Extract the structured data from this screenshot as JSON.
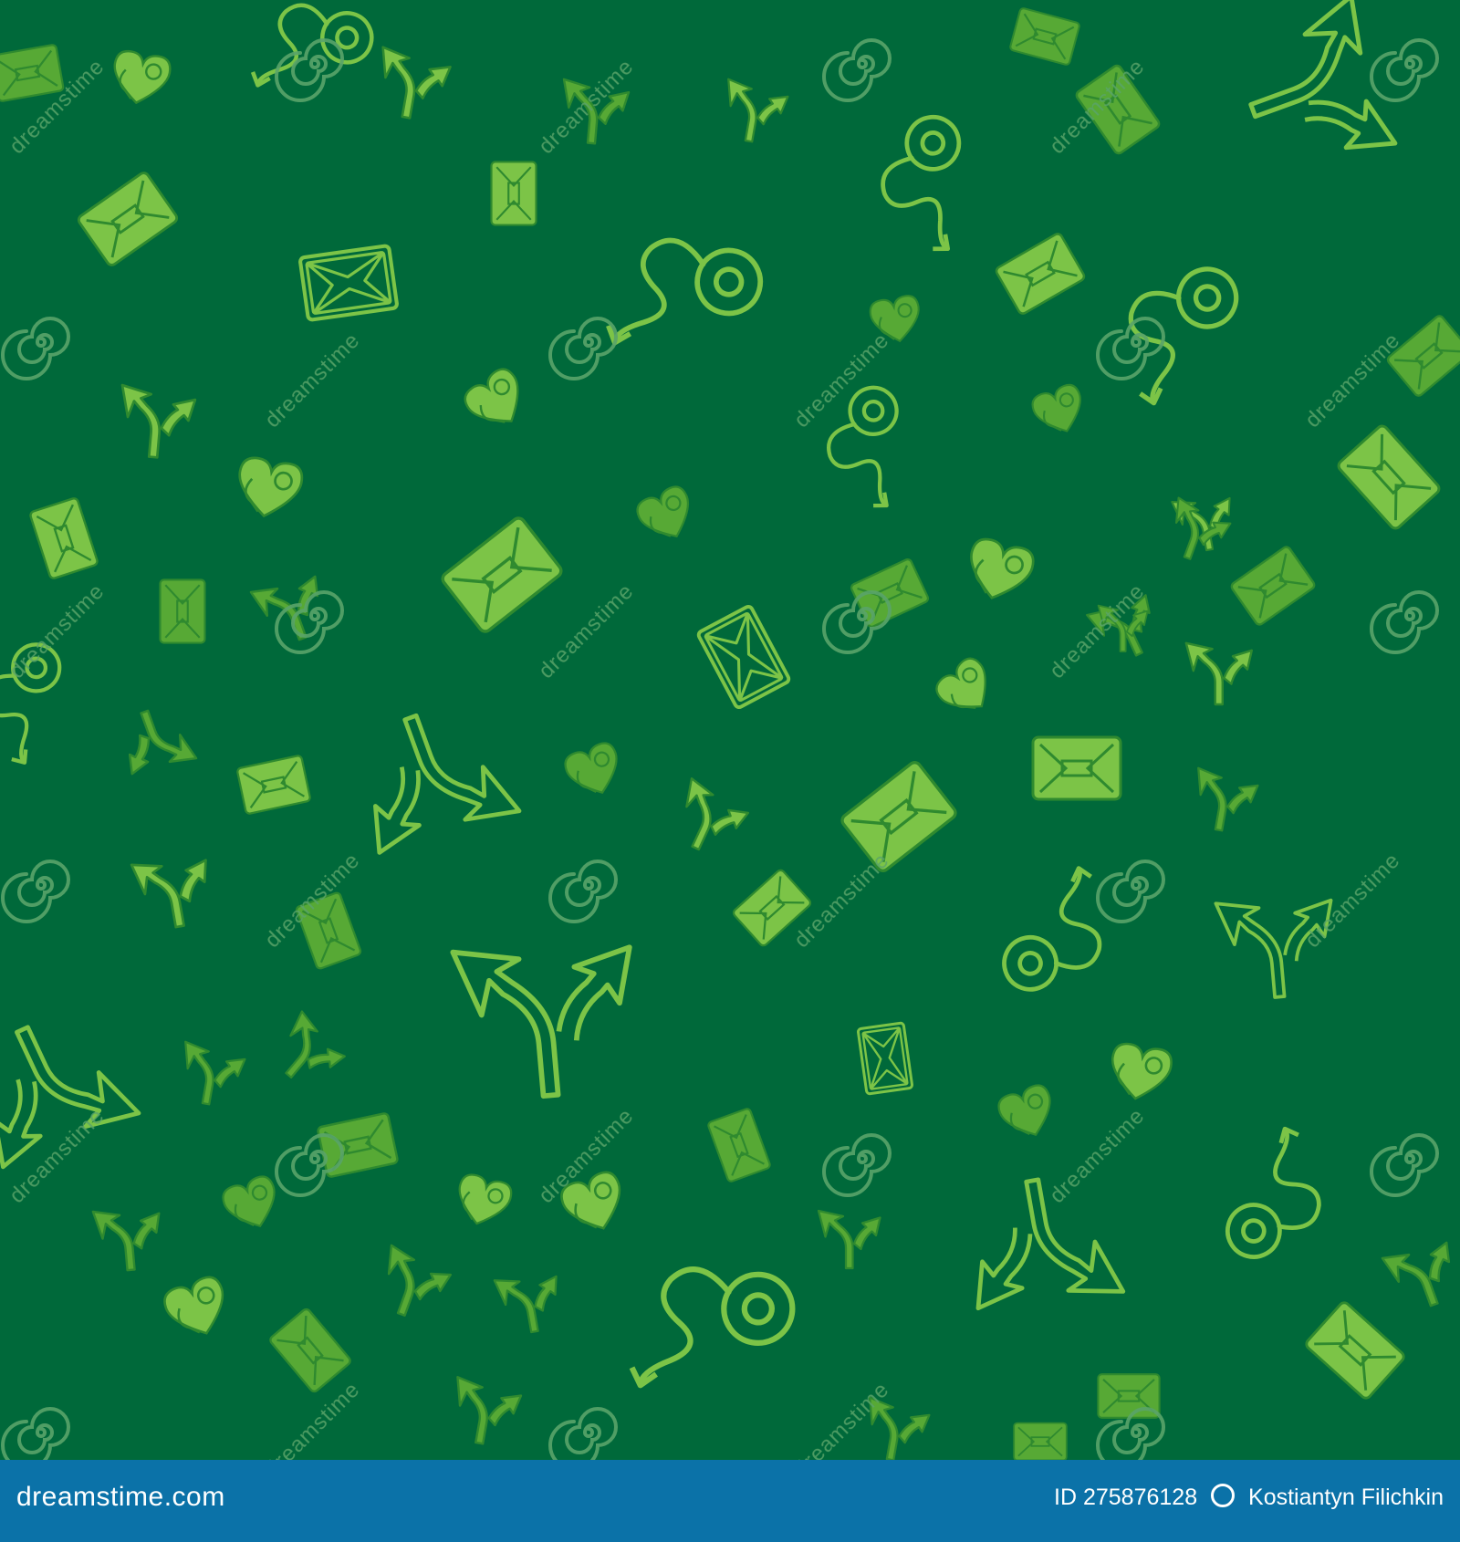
{
  "colors": {
    "background": "#00693a",
    "icon_light": "#7cc447",
    "icon_dim": "#57a935",
    "icon_stroke": "#2f8a2f",
    "watermark": "#5aa46a",
    "footer_bg": "#0b72a8",
    "footer_text": "#ffffff"
  },
  "pattern": {
    "icons": [
      "signpost-card-icon",
      "route-heart-icon",
      "road-fork-arrow-icon"
    ],
    "watermark_text": "dreamstime",
    "watermark_icon": "swirl-logo-icon"
  },
  "footer": {
    "site": "dreamstime.com",
    "id_text": "ID 275876128",
    "author": "Kostiantyn Filichkin"
  }
}
